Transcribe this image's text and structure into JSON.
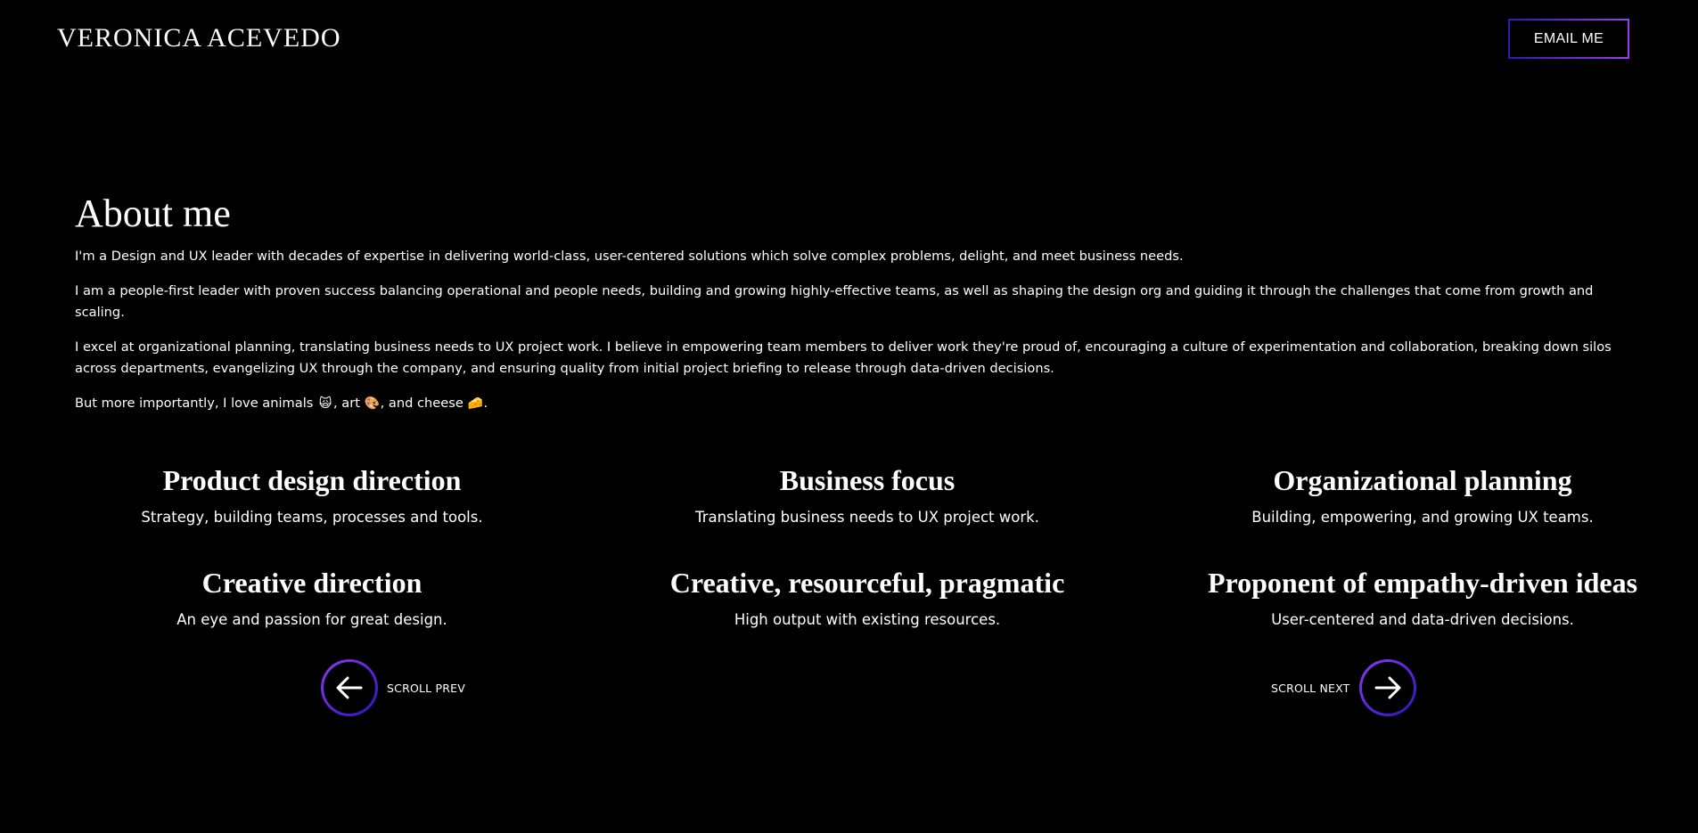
{
  "header": {
    "site_title": "VERONICA ACEVEDO",
    "email_label": "EMAIL ME"
  },
  "about": {
    "title": "About me",
    "paragraphs": [
      "I'm a Design and UX leader with decades of expertise in delivering world-class, user-centered solutions which solve complex problems, delight, and meet business needs.",
      "I am a people-first leader with proven success balancing operational and people needs, building and growing highly-effective teams, as well as shaping the design org and guiding it through the challenges that come from growth and scaling.",
      "I excel at organizational planning, translating business needs to UX project work. I believe in empowering team members to deliver work they're proud of, encouraging a culture of experimentation and collaboration, breaking down silos across departments, evangelizing UX through the company, and ensuring quality from initial project briefing to release through data-driven decisions."
    ],
    "fun_fact": {
      "intro": "But more importantly, I love animals",
      "animals_emoji": "🙀",
      "art_text": ", art",
      "art_emoji": "🎨",
      "cheese_text": ", and cheese",
      "cheese_emoji": "🧀",
      "end": "."
    }
  },
  "features": [
    {
      "title": "Product design direction",
      "desc": "Strategy, building teams, processes and tools."
    },
    {
      "title": "Business focus",
      "desc": "Translating business needs to UX project work."
    },
    {
      "title": "Organizational planning",
      "desc": "Building, empowering, and growing UX teams."
    },
    {
      "title": "Creative direction",
      "desc": "An eye and passion for great design."
    },
    {
      "title": "Creative, resourceful, pragmatic",
      "desc": "High output with existing resources."
    },
    {
      "title": "Proponent of empathy-driven ideas",
      "desc": "User-centered and data-driven decisions."
    }
  ],
  "scroll": {
    "prev_label": "SCROLL PREV",
    "next_label": "SCROLL NEXT",
    "prev_icon": "arrow-left-icon",
    "next_icon": "arrow-right-icon"
  },
  "colors": {
    "background": "#000000",
    "text": "#ffffff",
    "accent_start": "#2f12c0",
    "accent_end": "#9b3cf0"
  }
}
